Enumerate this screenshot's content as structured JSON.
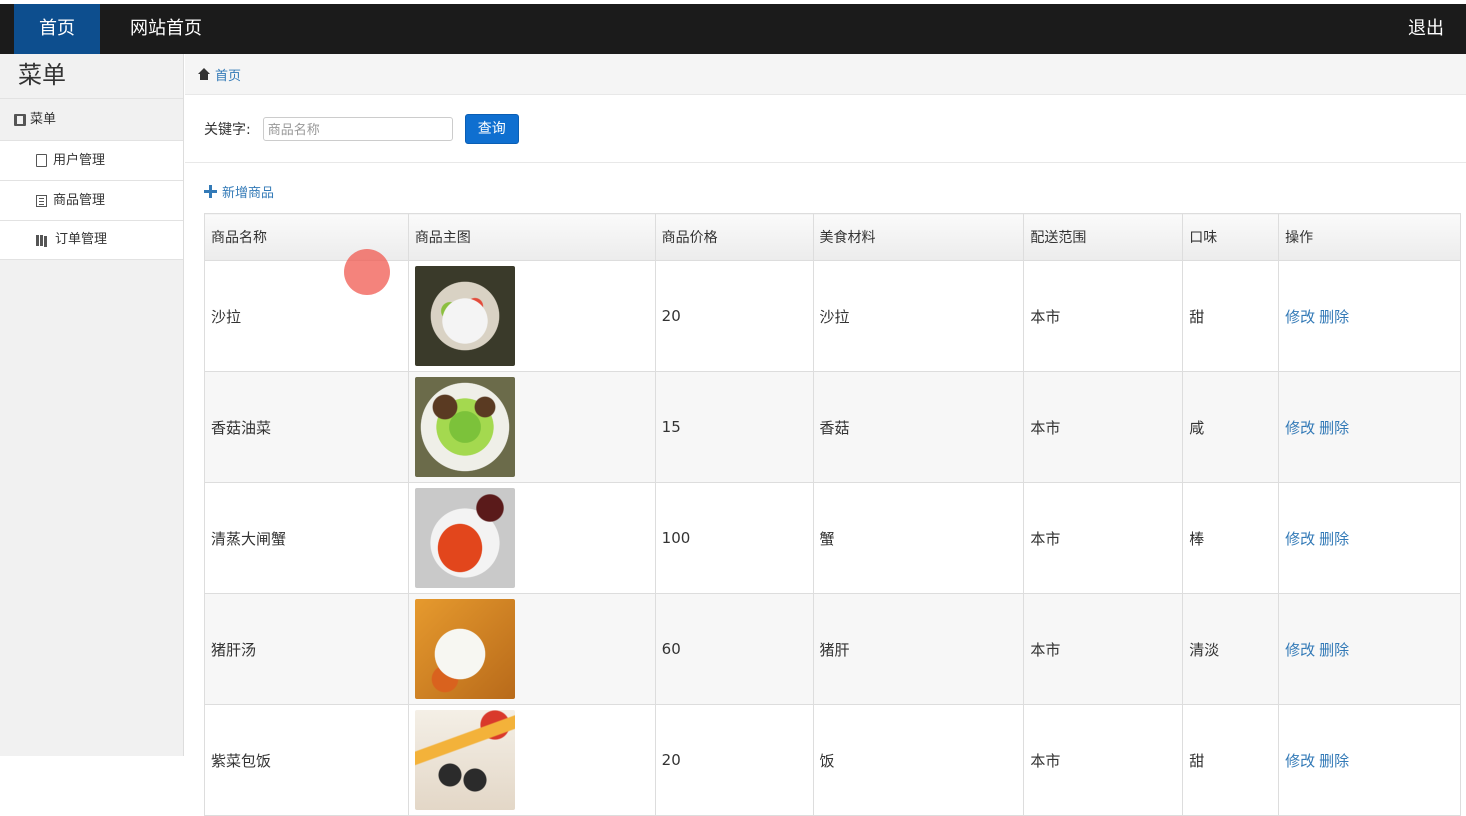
{
  "topbar": {
    "home": "首页",
    "site_home": "网站首页",
    "logout": "退出"
  },
  "sidebar": {
    "title": "菜单",
    "group_label": "菜单",
    "items": [
      {
        "label": "用户管理",
        "icon": "file-icon"
      },
      {
        "label": "商品管理",
        "icon": "list-icon"
      },
      {
        "label": "订单管理",
        "icon": "books-icon"
      }
    ]
  },
  "breadcrumb": {
    "home": "首页"
  },
  "search": {
    "label": "关键字:",
    "placeholder": "商品名称",
    "button": "查询"
  },
  "add_label": "新增商品",
  "table": {
    "headers": [
      "商品名称",
      "商品主图",
      "商品价格",
      "美食材料",
      "配送范围",
      "口味",
      "操作"
    ],
    "edit_label": "修改",
    "delete_label": "删除",
    "rows": [
      {
        "name": "沙拉",
        "price": "20",
        "material": "沙拉",
        "area": "本市",
        "taste": "甜"
      },
      {
        "name": "香菇油菜",
        "price": "15",
        "material": "香菇",
        "area": "本市",
        "taste": "咸"
      },
      {
        "name": "清蒸大闸蟹",
        "price": "100",
        "material": "蟹",
        "area": "本市",
        "taste": "棒"
      },
      {
        "name": "猪肝汤",
        "price": "60",
        "material": "猪肝",
        "area": "本市",
        "taste": "清淡"
      },
      {
        "name": "紫菜包饭",
        "price": "20",
        "material": "饭",
        "area": "本市",
        "taste": "甜"
      }
    ]
  },
  "colors": {
    "topbar": "#1b1b1b",
    "active_nav": "#0d4e8e",
    "link": "#337ab7",
    "button": "#0f6fd0"
  }
}
